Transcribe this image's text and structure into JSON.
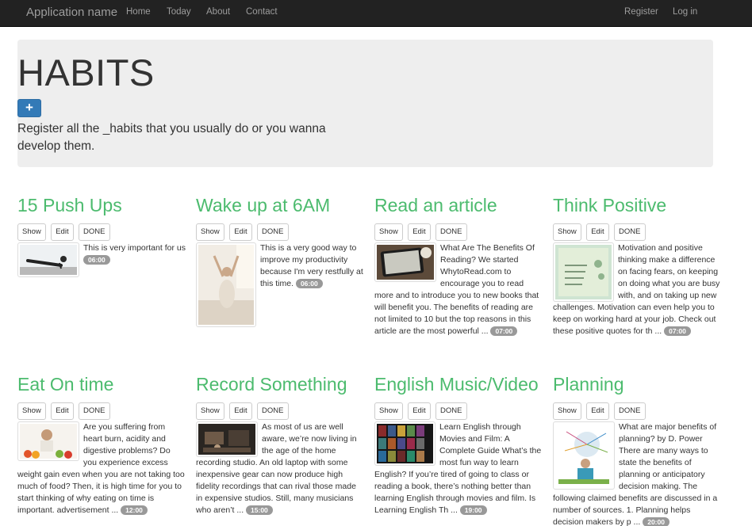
{
  "navbar": {
    "brand": "Application name",
    "links": [
      "Home",
      "Today",
      "About",
      "Contact"
    ],
    "right_links": [
      "Register",
      "Log in"
    ]
  },
  "jumbotron": {
    "title": "HABITS",
    "add_label": "+",
    "text": "Register all the _habits that you usually do or you wanna develop them."
  },
  "buttons": {
    "show": "Show",
    "edit": "Edit",
    "done": "DONE"
  },
  "habits": [
    {
      "title": "15 Push Ups",
      "text": "This is very important for us",
      "time": "06:00"
    },
    {
      "title": "Wake up at 6AM",
      "text": "This is a very good way to improve my productivity because I'm very restfully at this time.",
      "time": "06:00"
    },
    {
      "title": "Read an article",
      "text": "What Are The Benefits Of Reading? We started WhytoRead.com to encourage you to read more and to introduce you to new books that will benefit you. The benefits of reading are not limited to 10 but the top reasons in this article are the most powerful ...",
      "time": "07:00"
    },
    {
      "title": "Think Positive",
      "text": "Motivation and positive thinking make a difference on facing fears, on keeping on doing what you are busy with, and on taking up new challenges. Motivation can even help you to keep on working hard at your job. Check out these positive quotes for th ...",
      "time": "07:00"
    },
    {
      "title": "Eat On time",
      "text": "Are you suffering from heart burn, acidity and digestive problems? Do you experience excess weight gain even when you are not taking too much of food? Then, it is high time for you to start thinking of why eating on time is important. advertisement ...",
      "time": "12:00"
    },
    {
      "title": "Record Something",
      "text": "As most of us are well aware, we’re now living in the age of the home recording studio. An old laptop with some inexpensive gear can now produce high fidelity recordings that can rival those made in expensive studios. Still, many musicians who aren’t ...",
      "time": "15:00"
    },
    {
      "title": "English Music/Video",
      "text": "Learn English through Movies and Film: A Complete Guide What’s the most fun way to learn English? If you’re tired of going to class or reading a book, there’s nothing better than learning English through movies and film. Is Learning English Th ...",
      "time": "19:00"
    },
    {
      "title": "Planning",
      "text": "What are major benefits of planning? by D. Power There are many ways to state the benefits of planning or anticipatory decision making. The following claimed benefits are discussed in a number of sources. 1. Planning helps decision makers by p ...",
      "time": "20:00"
    }
  ]
}
